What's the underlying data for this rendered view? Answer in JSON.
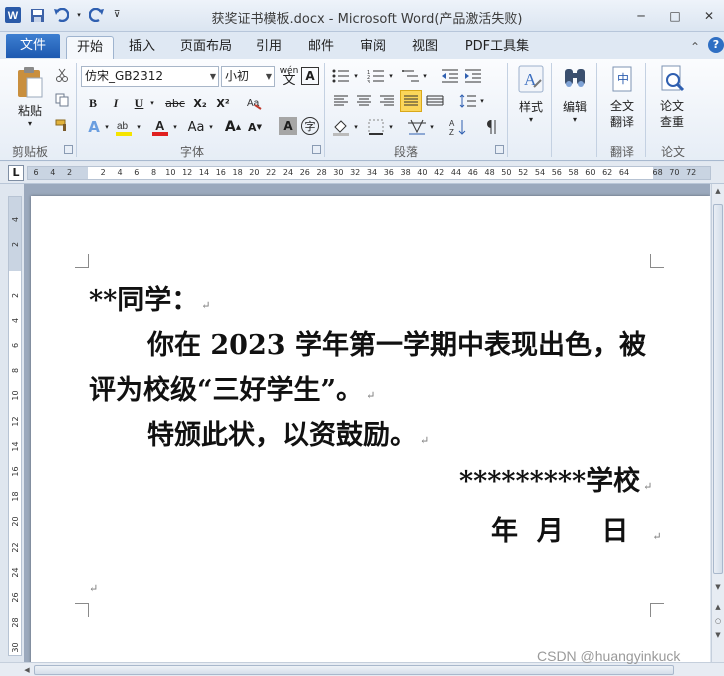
{
  "window": {
    "title": "获奖证书模板.docx - Microsoft Word(产品激活失败)",
    "minimize": "─",
    "maximize": "□",
    "close": "✕"
  },
  "tabs": {
    "file": "文件",
    "items": [
      "开始",
      "插入",
      "页面布局",
      "引用",
      "邮件",
      "审阅",
      "视图",
      "PDF工具集"
    ],
    "active": "开始",
    "help": "?"
  },
  "ribbon": {
    "clipboard": {
      "label": "剪贴板",
      "paste": "粘贴"
    },
    "font": {
      "label": "字体",
      "font_name": "仿宋_GB2312",
      "font_size": "小初",
      "bold": "B",
      "italic": "I",
      "underline": "U",
      "strike": "abc",
      "subscript": "X₂",
      "superscript": "X²",
      "grow": "A",
      "shrink": "A",
      "case": "Aa",
      "phonetic": "wén",
      "border_char": "A",
      "shade_char": "A",
      "enclose": "字"
    },
    "paragraph": {
      "label": "段落"
    },
    "styles": {
      "label": "样式",
      "button": "样式"
    },
    "editing": {
      "button": "编辑"
    },
    "translate": {
      "label": "翻译",
      "button": "全文\n翻译"
    },
    "paper": {
      "label": "论文",
      "button": "论文\n查重"
    }
  },
  "ruler": {
    "corner": "L",
    "h_ticks": [
      "6",
      "4",
      "2",
      "",
      "2",
      "4",
      "6",
      "8",
      "10",
      "12",
      "14",
      "16",
      "18",
      "20",
      "22",
      "24",
      "26",
      "28",
      "30",
      "32",
      "34",
      "36",
      "38",
      "40",
      "42",
      "44",
      "46",
      "48",
      "50",
      "52",
      "54",
      "56",
      "58",
      "60",
      "62",
      "64",
      "",
      "68",
      "70",
      "72"
    ],
    "v_ticks": [
      "4",
      "2",
      "",
      "2",
      "4",
      "6",
      "8",
      "10",
      "12",
      "14",
      "16",
      "18",
      "20",
      "22",
      "24",
      "26",
      "28",
      "30"
    ]
  },
  "document": {
    "lines": [
      "**同学：",
      "你在 2023 学年第一学期中表现出色，被",
      "评为校级“三好学生”。",
      "特颁此状，以资鼓励。",
      "*********学校",
      "年  月    日"
    ],
    "paragraph_mark": "↵"
  },
  "watermark": "CSDN @huangyinkuck"
}
